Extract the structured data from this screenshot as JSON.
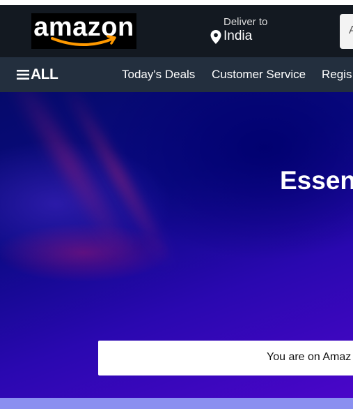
{
  "header": {
    "logo_text": "amazon",
    "deliver_label": "Deliver to",
    "deliver_country": "India",
    "search_select_text": "A"
  },
  "nav": {
    "all_label": "ALL",
    "links": [
      {
        "label": "Today's Deals"
      },
      {
        "label": "Customer Service"
      },
      {
        "label": "Regis"
      }
    ]
  },
  "hero": {
    "title": "Essent",
    "notice": "You are on Amaz"
  },
  "colors": {
    "header_bg": "#131921",
    "subnav_bg": "#232f3e",
    "logo_smile": "#ff9900",
    "hero_dark": "#050a6a",
    "hero_violet": "#4a06c9",
    "bottom_strip": "#8a8ff0"
  },
  "icons": {
    "location": "location-pin-icon",
    "menu": "hamburger-menu-icon",
    "logo_smile": "amazon-smile-arrow-icon"
  }
}
